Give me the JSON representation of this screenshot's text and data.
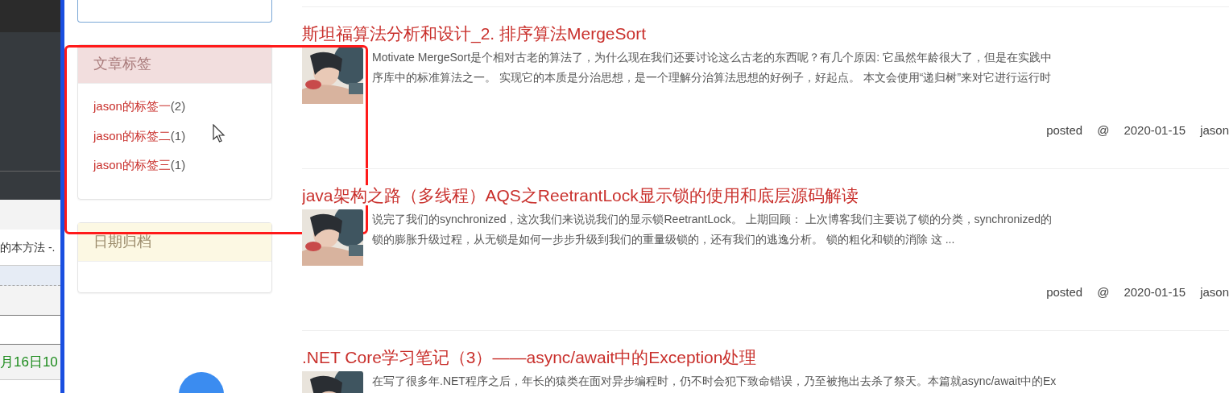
{
  "left_panel": {
    "snippet": "的本方法 -.",
    "date_fragment": "月16日10"
  },
  "sidebar": {
    "tag_card": {
      "title": "文章标签",
      "tags": [
        {
          "name": "jason的标签一",
          "count": "(2)"
        },
        {
          "name": "jason的标签二",
          "count": "(1)"
        },
        {
          "name": "jason的标签三",
          "count": "(1)"
        }
      ]
    },
    "archive_card": {
      "title": "日期归档"
    }
  },
  "posts": [
    {
      "title": "斯坦福算法分析和设计_2. 排序算法MergeSort",
      "summary": [
        "Motivate MergeSort是个相对古老的算法了，为什么现在我们还要讨论这么古老的东西呢？有几个原因: 它虽然年龄很大了，但是在实践中",
        "序库中的标准算法之一。 实现它的本质是分治思想，是一个理解分治算法思想的好例子，好起点。 本文会使用“递归树”来对它进行运行时"
      ],
      "meta": [
        "posted",
        "@",
        "2020-01-15",
        "jason"
      ]
    },
    {
      "title": "java架构之路（多线程）AQS之ReetrantLock显示锁的使用和底层源码解读",
      "summary": [
        "说完了我们的synchronized，这次我们来说说我们的显示锁ReetrantLock。 上期回顾： 上次博客我们主要说了锁的分类，synchronized的",
        "锁的膨胀升级过程，从无锁是如何一步步升级到我们的重量级锁的，还有我们的逃逸分析。 锁的粗化和锁的消除 这 ..."
      ],
      "meta": [
        "posted",
        "@",
        "2020-01-15",
        "jason"
      ]
    },
    {
      "title": ".NET Core学习笔记（3）——async/await中的Exception处理",
      "summary": [
        "在写了很多年.NET程序之后，年长的猿类在面对异步编程时，仍不时会犯下致命错误，乃至被拖出去杀了祭天。本篇就async/await中的Ex"
      ]
    }
  ]
}
